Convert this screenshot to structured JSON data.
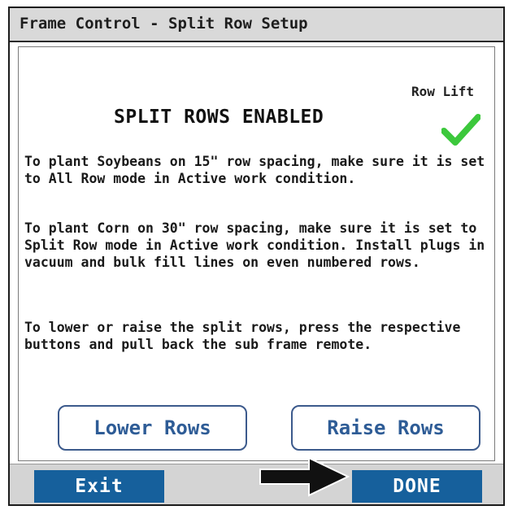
{
  "window": {
    "title": "Frame Control - Split Row Setup"
  },
  "status": {
    "row_lift_label": "Row Lift",
    "heading": "SPLIT ROWS ENABLED",
    "indicator_icon": "checkmark-icon",
    "indicator_color": "#3cc83c"
  },
  "instructions": [
    "To plant Soybeans on 15\" row spacing, make sure it is set to All Row mode in Active work condition.",
    "To plant Corn on 30\" row spacing, make sure it is set to Split Row mode in Active work condition. Install plugs in vacuum and bulk fill lines on even numbered rows.",
    "To lower or raise the split rows, press the respective buttons and pull back the sub frame remote."
  ],
  "actions": {
    "lower_label": "Lower Rows",
    "raise_label": "Raise Rows"
  },
  "footer": {
    "exit_label": "Exit",
    "done_label": "DONE",
    "accent_color": "#16609c",
    "pointer_icon": "arrow-right-icon"
  }
}
